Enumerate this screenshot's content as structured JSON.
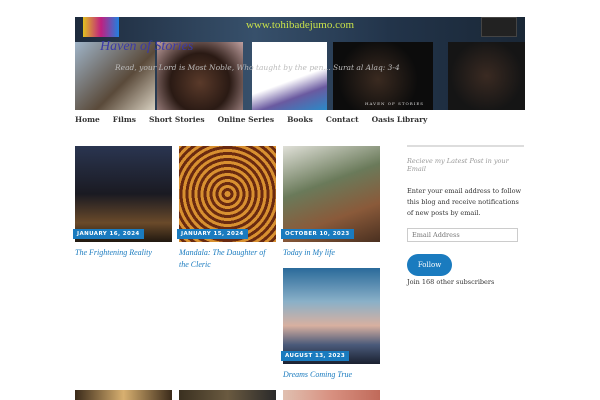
{
  "header": {
    "url": "www.tohibadejumo.com",
    "site_title": "Haven of Stories",
    "tagline": "Read, your Lord is Most Noble, Who taught by the pen... Surat al Alaq: 3-4",
    "caption": "HAVEN OF STORIES"
  },
  "nav": [
    "Home",
    "Films",
    "Short Stories",
    "Online Series",
    "Books",
    "Contact",
    "Oasis Library"
  ],
  "posts": [
    {
      "date": "JANUARY 16, 2024",
      "title": "The Frightening Reality"
    },
    {
      "date": "JANUARY 15, 2024",
      "title": "Mandala: The Daughter of the Cleric"
    },
    {
      "date": "OCTOBER 10, 2023",
      "title": "Today in My life"
    },
    {
      "date": "AUGUST 13, 2023",
      "title": "Dreams Coming True"
    }
  ],
  "sidebar": {
    "title": "Recieve my Latest Post in your Email",
    "text": "Enter your email address to follow this blog and receive notifications of new posts by email.",
    "placeholder": "Email Address",
    "button": "Follow",
    "subscribers": "Join 168 other subscribers"
  }
}
